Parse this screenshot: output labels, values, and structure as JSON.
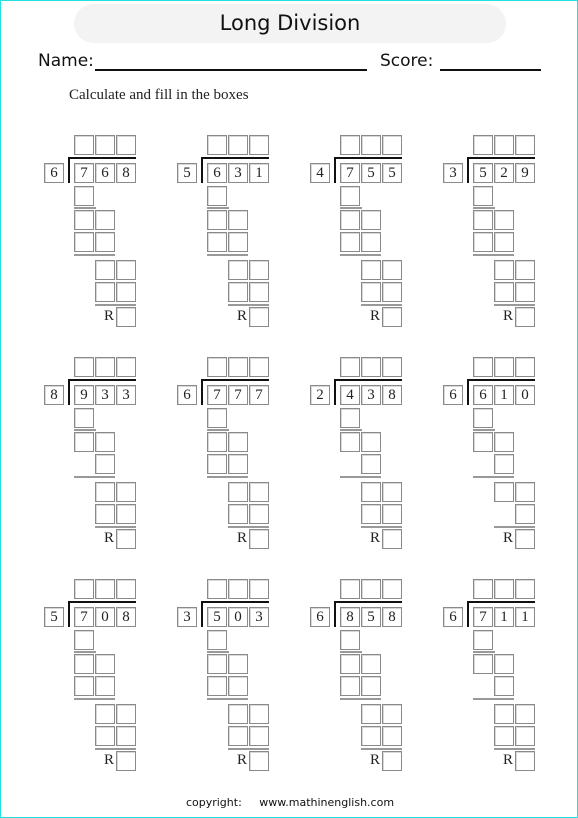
{
  "title": "Long Division",
  "name_label": "Name:",
  "score_label": "Score:",
  "instruction": "Calculate and fill in the boxes",
  "remainder_label": "R",
  "footer": {
    "copyright": "copyright:",
    "site": "www.mathinenglish.com"
  },
  "problems": [
    {
      "divisor": "6",
      "dividend": [
        "7",
        "6",
        "8"
      ],
      "row5_boxes": 2,
      "row7_boxes": 2
    },
    {
      "divisor": "5",
      "dividend": [
        "6",
        "3",
        "1"
      ],
      "row5_boxes": 2,
      "row7_boxes": 2
    },
    {
      "divisor": "4",
      "dividend": [
        "7",
        "5",
        "5"
      ],
      "row5_boxes": 2,
      "row7_boxes": 2
    },
    {
      "divisor": "3",
      "dividend": [
        "5",
        "2",
        "9"
      ],
      "row5_boxes": 2,
      "row7_boxes": 2
    },
    {
      "divisor": "8",
      "dividend": [
        "9",
        "3",
        "3"
      ],
      "row5_boxes": 1,
      "row7_boxes": 2
    },
    {
      "divisor": "6",
      "dividend": [
        "7",
        "7",
        "7"
      ],
      "row5_boxes": 2,
      "row7_boxes": 2
    },
    {
      "divisor": "2",
      "dividend": [
        "4",
        "3",
        "8"
      ],
      "row5_boxes": 1,
      "row7_boxes": 2
    },
    {
      "divisor": "6",
      "dividend": [
        "6",
        "1",
        "0"
      ],
      "row5_boxes": 1,
      "row7_boxes": 1
    },
    {
      "divisor": "5",
      "dividend": [
        "7",
        "0",
        "8"
      ],
      "row5_boxes": 2,
      "row7_boxes": 2
    },
    {
      "divisor": "3",
      "dividend": [
        "5",
        "0",
        "3"
      ],
      "row5_boxes": 2,
      "row7_boxes": 2
    },
    {
      "divisor": "6",
      "dividend": [
        "8",
        "5",
        "8"
      ],
      "row5_boxes": 2,
      "row7_boxes": 2
    },
    {
      "divisor": "6",
      "dividend": [
        "7",
        "1",
        "1"
      ],
      "row5_boxes": 1,
      "row7_boxes": 2
    }
  ]
}
